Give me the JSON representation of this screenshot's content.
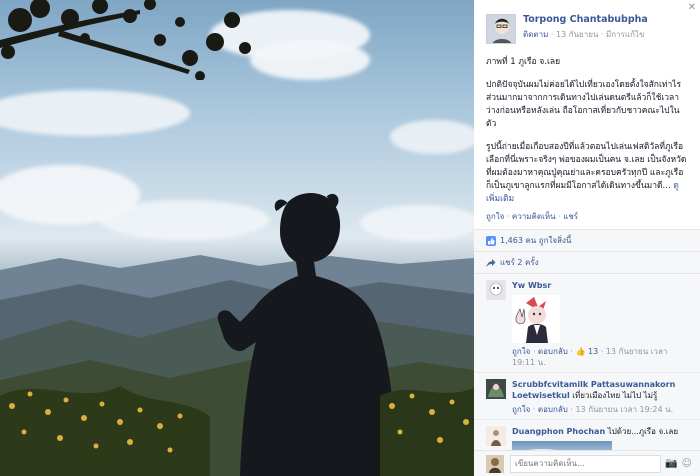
{
  "post": {
    "author": "Torpong Chantabubpha",
    "follow_label": "ติดตาม",
    "date": "13 กันยายน",
    "edited": "มีการแก้ไข",
    "title": "ภาพที่ 1 ภูเรือ จ.เลย",
    "paragraph1": "ปกติปัจจุบันผมไม่ค่อยได้ไปเที่ยวเองโดยตั้งใจสักเท่าไร ส่วนมากมาจากการเดินทางไปเล่นดนตรีแล้วก็ใช้เวลาว่างก่อนหรือหลังเล่น ถือโอกาสเที่ยวกับชาวคณะไปในตัว",
    "paragraph2": "รูปนี้ถ่ายเมื่อเกือบสองปีที่แล้วตอนไปเล่นเฟสติวัลที่ภูเรือ เลือกที่นี่เพราะจริงๆ พ่อของผมเป็นคน จ.เลย เป็นจังหวัดที่ผมต้องมาหาคุณปู่คุณย่าและครอบครัวทุกปี และภูเรือก็เป็นภูเขาลูกแรกที่ผมมีโอกาสได้เดินทางขึ้นมาดี...",
    "see_more": "ดูเพิ่มเติม",
    "actions": {
      "like": "ถูกใจ",
      "comment": "ความคิดเห็น",
      "share": "แชร์"
    },
    "like_count": "1,463 คน ถูกใจสิ่งนี้",
    "share_count": "แชร์ 2 ครั้ง"
  },
  "comments": [
    {
      "name": "Yw Wbsr",
      "text": "",
      "like": "ถูกใจ",
      "reply": "ตอบกลับ",
      "likes": "13",
      "time": "13 กันยายน เวลา 19:11 น.",
      "has_sticker": true
    },
    {
      "name": "Scrubbfcvitamilk Pattasuwannakorn Loetwisetkul",
      "text": "เที่ยวเมืองไทย ไม่ไป ไม่รู้",
      "like": "ถูกใจ",
      "reply": "ตอบกลับ",
      "time": "13 กันยายน เวลา 19:24 น."
    },
    {
      "name": "Duangphon Phochan",
      "text": "ไปด้วย...ภูเรือ จ.เลย",
      "has_image": true
    }
  ],
  "composer": {
    "placeholder": "เขียนความคิดเห็น..."
  },
  "icons": [
    "like-icon",
    "share-icon",
    "camera-icon",
    "emoji-icon",
    "close-icon"
  ],
  "colors": {
    "link": "#3b5998",
    "muted": "#90949c",
    "panel_bg": "#f6f7f9"
  }
}
